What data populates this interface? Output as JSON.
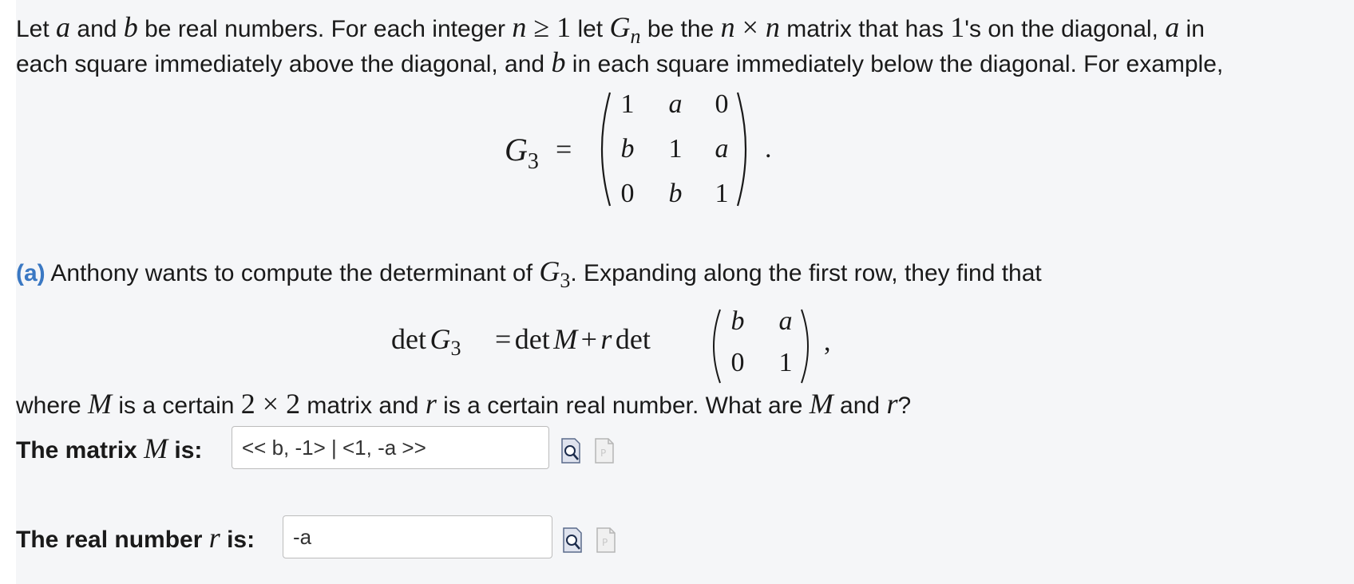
{
  "problem": {
    "intro_line1": {
      "t1": "Let ",
      "v_a": "a",
      "t2": " and ",
      "v_b": "b",
      "t3": " be real numbers. For each integer ",
      "v_n": "n",
      "op_ge": " ≥ 1",
      "t4": " let ",
      "v_G": "G",
      "v_n2": "n",
      "t5": " be the ",
      "v_n3": "n",
      "op_x": " × ",
      "v_n4": "n",
      "t6": " matrix that has ",
      "num1": "1",
      "t7": "'s on the diagonal, ",
      "v_a2": "a",
      "t8": " in"
    },
    "intro_line2": {
      "t1": "each square immediately above the diagonal, and ",
      "v_b": "b",
      "t2": " in each square immediately below the diagonal. For example,"
    },
    "example": {
      "lhs_var": "G",
      "lhs_sub": "3",
      "eq": "=",
      "end": ".",
      "matrix": [
        [
          "1",
          "a",
          "0"
        ],
        [
          "b",
          "1",
          "a"
        ],
        [
          "0",
          "b",
          "1"
        ]
      ]
    }
  },
  "part_a": {
    "label": "(a)",
    "sentence": {
      "t1": " Anthony wants to compute the determinant of ",
      "v_G": "G",
      "sub": "3",
      "t2": ". Expanding along the first row, they find that"
    },
    "equation": {
      "det1": "det",
      "v_G": "G",
      "sub": "3",
      "eq": "=",
      "det2": "det",
      "v_M": "M",
      "plus": "+",
      "v_r": "r",
      "det3": "det",
      "end": ",",
      "matrix": [
        [
          "b",
          "a"
        ],
        [
          "0",
          "1"
        ]
      ]
    },
    "where": {
      "t1": "where ",
      "v_M": "M",
      "t2": " is a certain ",
      "dim": "2 × 2",
      "t3": " matrix and ",
      "v_r": "r",
      "t4": " is a certain real number. What are ",
      "v_M2": "M",
      "t5": " and ",
      "v_r2": "r",
      "t6": "?"
    },
    "answers": [
      {
        "label_pre": "The matrix ",
        "var": "M",
        "label_post": " is:",
        "value": "<< b, -1> | <1, -a >>"
      },
      {
        "label_pre": "The real number ",
        "var": "r",
        "label_post": " is:",
        "value": "-a"
      }
    ],
    "icons": [
      "preview-icon",
      "file-icon"
    ]
  },
  "colors": {
    "panel": "#f5f6f8",
    "part_label": "#3a78c3",
    "input_border": "#bcbcbc"
  }
}
